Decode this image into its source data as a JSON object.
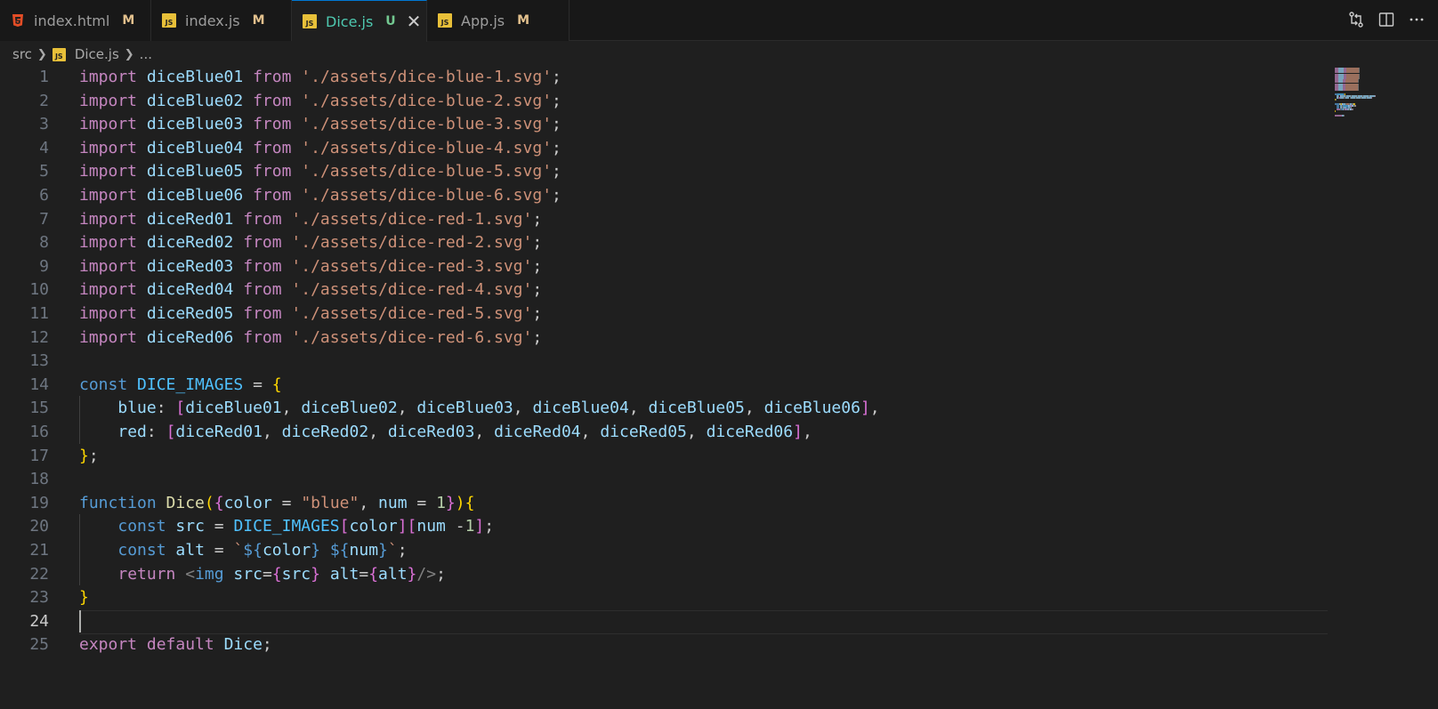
{
  "tabs": [
    {
      "name": "index.html",
      "badge": "M",
      "icon": "html5-icon",
      "active": false
    },
    {
      "name": "index.js",
      "badge": "M",
      "icon": "js-file-icon",
      "active": false
    },
    {
      "name": "Dice.js",
      "badge": "U",
      "icon": "js-file-icon",
      "active": true
    },
    {
      "name": "App.js",
      "badge": "M",
      "icon": "js-file-icon",
      "active": false
    }
  ],
  "breadcrumb": {
    "folder": "src",
    "file": "Dice.js",
    "more": "..."
  },
  "js_icon_label": "JS",
  "code_lines": [
    [
      [
        "kw",
        "import "
      ],
      [
        "vr",
        "diceBlue01 "
      ],
      [
        "kw",
        "from "
      ],
      [
        "st",
        "'./assets/dice-blue-1.svg'"
      ],
      [
        "pl",
        ";"
      ]
    ],
    [
      [
        "kw",
        "import "
      ],
      [
        "vr",
        "diceBlue02 "
      ],
      [
        "kw",
        "from "
      ],
      [
        "st",
        "'./assets/dice-blue-2.svg'"
      ],
      [
        "pl",
        ";"
      ]
    ],
    [
      [
        "kw",
        "import "
      ],
      [
        "vr",
        "diceBlue03 "
      ],
      [
        "kw",
        "from "
      ],
      [
        "st",
        "'./assets/dice-blue-3.svg'"
      ],
      [
        "pl",
        ";"
      ]
    ],
    [
      [
        "kw",
        "import "
      ],
      [
        "vr",
        "diceBlue04 "
      ],
      [
        "kw",
        "from "
      ],
      [
        "st",
        "'./assets/dice-blue-4.svg'"
      ],
      [
        "pl",
        ";"
      ]
    ],
    [
      [
        "kw",
        "import "
      ],
      [
        "vr",
        "diceBlue05 "
      ],
      [
        "kw",
        "from "
      ],
      [
        "st",
        "'./assets/dice-blue-5.svg'"
      ],
      [
        "pl",
        ";"
      ]
    ],
    [
      [
        "kw",
        "import "
      ],
      [
        "vr",
        "diceBlue06 "
      ],
      [
        "kw",
        "from "
      ],
      [
        "st",
        "'./assets/dice-blue-6.svg'"
      ],
      [
        "pl",
        ";"
      ]
    ],
    [
      [
        "kw",
        "import "
      ],
      [
        "vr",
        "diceRed01 "
      ],
      [
        "kw",
        "from "
      ],
      [
        "st",
        "'./assets/dice-red-1.svg'"
      ],
      [
        "pl",
        ";"
      ]
    ],
    [
      [
        "kw",
        "import "
      ],
      [
        "vr",
        "diceRed02 "
      ],
      [
        "kw",
        "from "
      ],
      [
        "st",
        "'./assets/dice-red-2.svg'"
      ],
      [
        "pl",
        ";"
      ]
    ],
    [
      [
        "kw",
        "import "
      ],
      [
        "vr",
        "diceRed03 "
      ],
      [
        "kw",
        "from "
      ],
      [
        "st",
        "'./assets/dice-red-3.svg'"
      ],
      [
        "pl",
        ";"
      ]
    ],
    [
      [
        "kw",
        "import "
      ],
      [
        "vr",
        "diceRed04 "
      ],
      [
        "kw",
        "from "
      ],
      [
        "st",
        "'./assets/dice-red-4.svg'"
      ],
      [
        "pl",
        ";"
      ]
    ],
    [
      [
        "kw",
        "import "
      ],
      [
        "vr",
        "diceRed05 "
      ],
      [
        "kw",
        "from "
      ],
      [
        "st",
        "'./assets/dice-red-5.svg'"
      ],
      [
        "pl",
        ";"
      ]
    ],
    [
      [
        "kw",
        "import "
      ],
      [
        "vr",
        "diceRed06 "
      ],
      [
        "kw",
        "from "
      ],
      [
        "st",
        "'./assets/dice-red-6.svg'"
      ],
      [
        "pl",
        ";"
      ]
    ],
    [],
    [
      [
        "sk",
        "const "
      ],
      [
        "cn",
        "DICE_IMAGES "
      ],
      [
        "pl",
        "= "
      ],
      [
        "b1",
        "{"
      ]
    ],
    [
      [
        "pl",
        "    "
      ],
      [
        "vr",
        "blue"
      ],
      [
        "pl",
        ": "
      ],
      [
        "b2",
        "["
      ],
      [
        "vr",
        "diceBlue01"
      ],
      [
        "pl",
        ", "
      ],
      [
        "vr",
        "diceBlue02"
      ],
      [
        "pl",
        ", "
      ],
      [
        "vr",
        "diceBlue03"
      ],
      [
        "pl",
        ", "
      ],
      [
        "vr",
        "diceBlue04"
      ],
      [
        "pl",
        ", "
      ],
      [
        "vr",
        "diceBlue05"
      ],
      [
        "pl",
        ", "
      ],
      [
        "vr",
        "diceBlue06"
      ],
      [
        "b2",
        "]"
      ],
      [
        "pl",
        ","
      ]
    ],
    [
      [
        "pl",
        "    "
      ],
      [
        "vr",
        "red"
      ],
      [
        "pl",
        ": "
      ],
      [
        "b2",
        "["
      ],
      [
        "vr",
        "diceRed01"
      ],
      [
        "pl",
        ", "
      ],
      [
        "vr",
        "diceRed02"
      ],
      [
        "pl",
        ", "
      ],
      [
        "vr",
        "diceRed03"
      ],
      [
        "pl",
        ", "
      ],
      [
        "vr",
        "diceRed04"
      ],
      [
        "pl",
        ", "
      ],
      [
        "vr",
        "diceRed05"
      ],
      [
        "pl",
        ", "
      ],
      [
        "vr",
        "diceRed06"
      ],
      [
        "b2",
        "]"
      ],
      [
        "pl",
        ","
      ]
    ],
    [
      [
        "b1",
        "}"
      ],
      [
        "pl",
        ";"
      ]
    ],
    [],
    [
      [
        "sk",
        "function "
      ],
      [
        "fn",
        "Dice"
      ],
      [
        "b1",
        "("
      ],
      [
        "b2",
        "{"
      ],
      [
        "vr",
        "color "
      ],
      [
        "pl",
        "= "
      ],
      [
        "st",
        "\"blue\""
      ],
      [
        "pl",
        ", "
      ],
      [
        "vr",
        "num "
      ],
      [
        "pl",
        "= "
      ],
      [
        "nu",
        "1"
      ],
      [
        "b2",
        "}"
      ],
      [
        "b1",
        ")"
      ],
      [
        "b1",
        "{"
      ]
    ],
    [
      [
        "pl",
        "    "
      ],
      [
        "sk",
        "const "
      ],
      [
        "vr",
        "src "
      ],
      [
        "pl",
        "= "
      ],
      [
        "cn",
        "DICE_IMAGES"
      ],
      [
        "b2",
        "["
      ],
      [
        "vr",
        "color"
      ],
      [
        "b2",
        "]"
      ],
      [
        "b2",
        "["
      ],
      [
        "vr",
        "num "
      ],
      [
        "pl",
        "-"
      ],
      [
        "nu",
        "1"
      ],
      [
        "b2",
        "]"
      ],
      [
        "pl",
        ";"
      ]
    ],
    [
      [
        "pl",
        "    "
      ],
      [
        "sk",
        "const "
      ],
      [
        "vr",
        "alt "
      ],
      [
        "pl",
        "= "
      ],
      [
        "st",
        "`"
      ],
      [
        "sk",
        "${"
      ],
      [
        "vr",
        "color"
      ],
      [
        "sk",
        "}"
      ],
      [
        "st",
        " "
      ],
      [
        "sk",
        "${"
      ],
      [
        "vr",
        "num"
      ],
      [
        "sk",
        "}"
      ],
      [
        "st",
        "`"
      ],
      [
        "pl",
        ";"
      ]
    ],
    [
      [
        "pl",
        "    "
      ],
      [
        "kw",
        "return "
      ],
      [
        "tg",
        "<"
      ],
      [
        "sk",
        "img "
      ],
      [
        "vr",
        "src"
      ],
      [
        "pl",
        "="
      ],
      [
        "b2",
        "{"
      ],
      [
        "vr",
        "src"
      ],
      [
        "b2",
        "}"
      ],
      [
        "pl",
        " "
      ],
      [
        "vr",
        "alt"
      ],
      [
        "pl",
        "="
      ],
      [
        "b2",
        "{"
      ],
      [
        "vr",
        "alt"
      ],
      [
        "b2",
        "}"
      ],
      [
        "tg",
        "/>"
      ],
      [
        "pl",
        ";"
      ]
    ],
    [
      [
        "b1",
        "}"
      ]
    ],
    [],
    [
      [
        "kw",
        "export default "
      ],
      [
        "vr",
        "Dice"
      ],
      [
        "pl",
        ";"
      ]
    ]
  ],
  "current_line": 24
}
